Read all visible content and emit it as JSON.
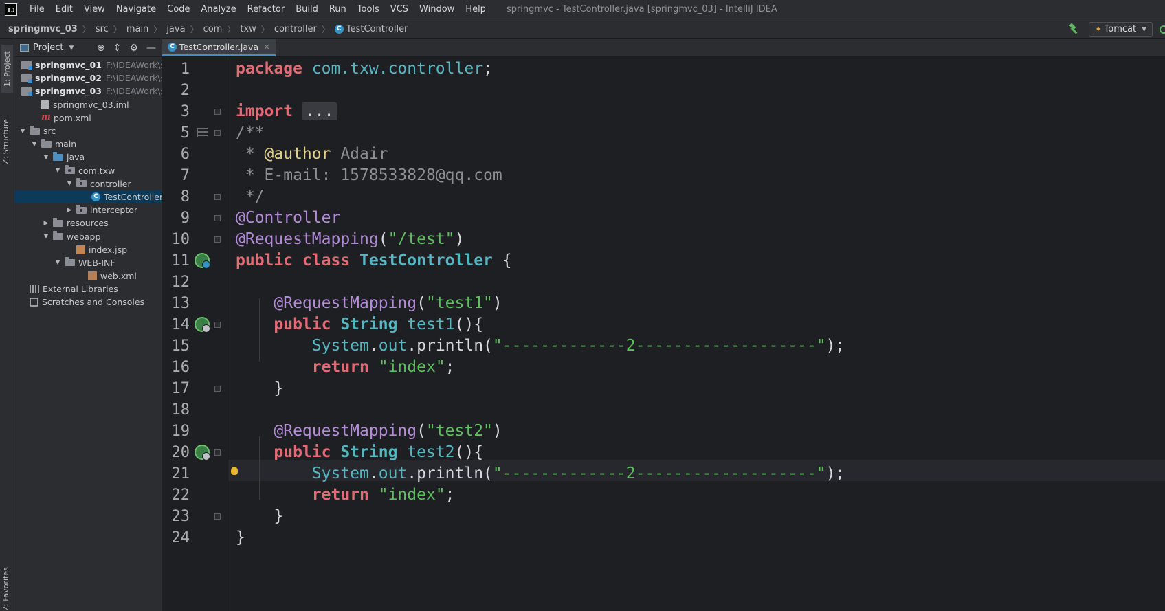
{
  "menubar": {
    "logo": "IJ",
    "items": [
      "File",
      "Edit",
      "View",
      "Navigate",
      "Code",
      "Analyze",
      "Refactor",
      "Build",
      "Run",
      "Tools",
      "VCS",
      "Window",
      "Help"
    ],
    "window_title": "springmvc - TestController.java [springmvc_03] - IntelliJ IDEA"
  },
  "navbar": {
    "breadcrumbs": [
      "springmvc_03",
      "src",
      "main",
      "java",
      "com",
      "txw",
      "controller",
      "TestController"
    ],
    "class_icon_letter": "C",
    "run_config": "Tomcat"
  },
  "tool_stripe": {
    "project": "1: Project",
    "structure": "Z: Structure",
    "favorites": "2: Favorites"
  },
  "project_panel": {
    "title": "Project",
    "tree": [
      {
        "label": "springmvc_01",
        "path": "F:\\IDEAWork\\sprin",
        "type": "module",
        "depth": 0
      },
      {
        "label": "springmvc_02",
        "path": "F:\\IDEAWork\\sprin",
        "type": "module",
        "depth": 0
      },
      {
        "label": "springmvc_03",
        "path": "F:\\IDEAWork\\sprin",
        "type": "module",
        "depth": 0
      },
      {
        "label": "springmvc_03.iml",
        "type": "file",
        "depth": 1
      },
      {
        "label": "pom.xml",
        "type": "maven",
        "depth": 1
      },
      {
        "label": "src",
        "type": "folder",
        "depth": 0,
        "expanded": true
      },
      {
        "label": "main",
        "type": "folder",
        "depth": 1,
        "expanded": true
      },
      {
        "label": "java",
        "type": "folder-blue",
        "depth": 2,
        "expanded": true
      },
      {
        "label": "com.txw",
        "type": "pkg",
        "depth": 3,
        "expanded": true
      },
      {
        "label": "controller",
        "type": "pkg",
        "depth": 4,
        "expanded": true
      },
      {
        "label": "TestController",
        "type": "class",
        "depth": 6,
        "selected": true
      },
      {
        "label": "interceptor",
        "type": "pkg",
        "depth": 4,
        "expanded": false
      },
      {
        "label": "resources",
        "type": "folder",
        "depth": 2,
        "expanded": false
      },
      {
        "label": "webapp",
        "type": "folder",
        "depth": 2,
        "expanded": true
      },
      {
        "label": "index.jsp",
        "type": "jsp",
        "depth": 4
      },
      {
        "label": "WEB-INF",
        "type": "folder",
        "depth": 3,
        "expanded": true
      },
      {
        "label": "web.xml",
        "type": "xml",
        "depth": 5
      },
      {
        "label": "External Libraries",
        "type": "libs",
        "depth": 0
      },
      {
        "label": "Scratches and Consoles",
        "type": "scratch",
        "depth": 0
      }
    ]
  },
  "editor": {
    "tab_label": "TestController.java",
    "tab_close": "×",
    "current_line": 21,
    "lines": [
      {
        "n": "1",
        "tokens": [
          [
            "kw2",
            "package"
          ],
          [
            "plain",
            " "
          ],
          [
            "pk",
            "com.txw.controller"
          ],
          [
            "plain",
            ";"
          ]
        ]
      },
      {
        "n": "2",
        "tokens": []
      },
      {
        "n": "3",
        "tokens": [
          [
            "kw2",
            "import"
          ],
          [
            "plain",
            " "
          ],
          [
            "fold",
            "..."
          ]
        ]
      },
      {
        "n": "5",
        "tokens": [
          [
            "cmt",
            "/**"
          ]
        ]
      },
      {
        "n": "6",
        "tokens": [
          [
            "cmt",
            " * "
          ],
          [
            "tag",
            "@author"
          ],
          [
            "cmt",
            " Adair"
          ]
        ]
      },
      {
        "n": "7",
        "tokens": [
          [
            "cmt",
            " * E-mail: 1578533828@qq.com"
          ]
        ]
      },
      {
        "n": "8",
        "tokens": [
          [
            "cmt",
            " */"
          ]
        ]
      },
      {
        "n": "9",
        "tokens": [
          [
            "ann",
            "@Controller"
          ]
        ]
      },
      {
        "n": "10",
        "tokens": [
          [
            "ann",
            "@RequestMapping"
          ],
          [
            "plain",
            "("
          ],
          [
            "str",
            "\"/test\""
          ],
          [
            "plain",
            ")"
          ]
        ]
      },
      {
        "n": "11",
        "tokens": [
          [
            "kw2",
            "public class"
          ],
          [
            "plain",
            " "
          ],
          [
            "cls",
            "TestController"
          ],
          [
            "plain",
            " {"
          ]
        ]
      },
      {
        "n": "12",
        "tokens": []
      },
      {
        "n": "13",
        "tokens": [
          [
            "plain",
            "    "
          ],
          [
            "ann",
            "@RequestMapping"
          ],
          [
            "plain",
            "("
          ],
          [
            "str",
            "\"test1\""
          ],
          [
            "plain",
            ")"
          ]
        ]
      },
      {
        "n": "14",
        "tokens": [
          [
            "plain",
            "    "
          ],
          [
            "kw2",
            "public"
          ],
          [
            "plain",
            " "
          ],
          [
            "cls",
            "String"
          ],
          [
            "plain",
            " "
          ],
          [
            "pk",
            "test1"
          ],
          [
            "plain",
            "(){"
          ]
        ]
      },
      {
        "n": "15",
        "tokens": [
          [
            "plain",
            "        "
          ],
          [
            "pk",
            "System"
          ],
          [
            "plain",
            "."
          ],
          [
            "pk",
            "out"
          ],
          [
            "plain",
            ".println("
          ],
          [
            "str",
            "\"-------------2-------------------\""
          ],
          [
            "plain",
            ");"
          ]
        ]
      },
      {
        "n": "16",
        "tokens": [
          [
            "plain",
            "        "
          ],
          [
            "kw2",
            "return"
          ],
          [
            "plain",
            " "
          ],
          [
            "str",
            "\"index\""
          ],
          [
            "plain",
            ";"
          ]
        ]
      },
      {
        "n": "17",
        "tokens": [
          [
            "plain",
            "    }"
          ]
        ]
      },
      {
        "n": "18",
        "tokens": []
      },
      {
        "n": "19",
        "tokens": [
          [
            "plain",
            "    "
          ],
          [
            "ann",
            "@RequestMapping"
          ],
          [
            "plain",
            "("
          ],
          [
            "str",
            "\"test2\""
          ],
          [
            "plain",
            ")"
          ]
        ]
      },
      {
        "n": "20",
        "tokens": [
          [
            "plain",
            "    "
          ],
          [
            "kw2",
            "public"
          ],
          [
            "plain",
            " "
          ],
          [
            "cls",
            "String"
          ],
          [
            "plain",
            " "
          ],
          [
            "pk",
            "test2"
          ],
          [
            "plain",
            "(){"
          ]
        ]
      },
      {
        "n": "21",
        "tokens": [
          [
            "plain",
            "        "
          ],
          [
            "pk",
            "System"
          ],
          [
            "plain",
            "."
          ],
          [
            "pk",
            "out"
          ],
          [
            "plain",
            ".println("
          ],
          [
            "str",
            "\"-------------2-------------------\""
          ],
          [
            "plain",
            ");"
          ]
        ]
      },
      {
        "n": "22",
        "tokens": [
          [
            "plain",
            "        "
          ],
          [
            "kw2",
            "return"
          ],
          [
            "plain",
            " "
          ],
          [
            "str",
            "\"index\""
          ],
          [
            "plain",
            ";"
          ]
        ]
      },
      {
        "n": "23",
        "tokens": [
          [
            "plain",
            "    }"
          ]
        ]
      },
      {
        "n": "24",
        "tokens": [
          [
            "plain",
            "}"
          ]
        ]
      }
    ]
  },
  "colors": {
    "editor_bg": "#1e1f22",
    "panel_bg": "#2b2d30",
    "selection": "#0d3a58",
    "keyword": "#e06c75",
    "annotation": "#b38bd6",
    "string": "#5fbf60",
    "type": "#56b6c2",
    "comment": "#8c8f94"
  },
  "icons": {
    "gutter_class_icon": "spring-class-gutter-icon",
    "gutter_web_icon": "spring-web-gutter-icon",
    "bulb": "intention-bulb-icon"
  }
}
